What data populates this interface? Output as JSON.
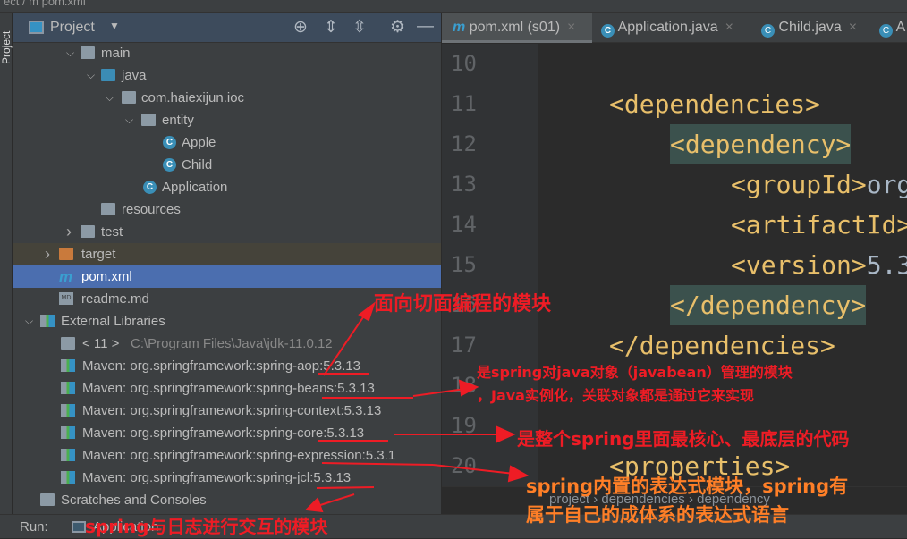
{
  "breadcrumb_top": "ect / m pom.xml",
  "side_stripe": "Project",
  "panel": {
    "title": "Project",
    "icons": [
      "locate-icon",
      "expand-all-icon",
      "collapse-all-icon",
      "gear-icon",
      "minimize-icon"
    ]
  },
  "tree": [
    {
      "label": "main",
      "type": "folder",
      "expanded": true
    },
    {
      "label": "java",
      "type": "source-folder",
      "expanded": true
    },
    {
      "label": "com.haiexijun.ioc",
      "type": "package",
      "expanded": true
    },
    {
      "label": "entity",
      "type": "package",
      "expanded": true
    },
    {
      "label": "Apple",
      "type": "class"
    },
    {
      "label": "Child",
      "type": "class"
    },
    {
      "label": "Application",
      "type": "main-class"
    },
    {
      "label": "resources",
      "type": "resources-folder"
    },
    {
      "label": "test",
      "type": "folder",
      "expanded": false
    },
    {
      "label": "target",
      "type": "excluded-folder",
      "expanded": false
    },
    {
      "label": "pom.xml",
      "type": "maven",
      "selected": true
    },
    {
      "label": "readme.md",
      "type": "markdown"
    },
    {
      "label": "External Libraries",
      "type": "libraries",
      "expanded": true
    },
    {
      "label": "< 11 >",
      "extra": "C:\\Program Files\\Java\\jdk-11.0.12",
      "type": "jdk"
    },
    {
      "label": "Maven: org.springframework:spring-aop:5.3.13",
      "type": "lib"
    },
    {
      "label": "Maven: org.springframework:spring-beans:5.3.13",
      "type": "lib"
    },
    {
      "label": "Maven: org.springframework:spring-context:5.3.13",
      "type": "lib"
    },
    {
      "label": "Maven: org.springframework:spring-core:5.3.13",
      "type": "lib"
    },
    {
      "label": "Maven: org.springframework:spring-expression:5.3.1",
      "type": "lib"
    },
    {
      "label": "Maven: org.springframework:spring-jcl:5.3.13",
      "type": "lib"
    },
    {
      "label": "Scratches and Consoles",
      "type": "scratches"
    }
  ],
  "tabs": [
    {
      "label": "pom.xml (s01)",
      "icon": "maven-icon",
      "active": true
    },
    {
      "label": "Application.java",
      "icon": "main-class-icon"
    },
    {
      "label": "Child.java",
      "icon": "class-icon"
    },
    {
      "label": "A",
      "icon": "class-icon"
    }
  ],
  "code_lines": [
    {
      "num": "10",
      "text": ""
    },
    {
      "num": "11",
      "text": "<dependencies>"
    },
    {
      "num": "12",
      "text": "<dependency>"
    },
    {
      "num": "13",
      "text": "<groupId>",
      "value": "org"
    },
    {
      "num": "14",
      "text": "<artifactId>"
    },
    {
      "num": "15",
      "text": "<version>",
      "value": "5.3"
    },
    {
      "num": "16",
      "text": "</dependency>"
    },
    {
      "num": "17",
      "text": "</dependencies>"
    },
    {
      "num": "18",
      "text": ""
    },
    {
      "num": "19",
      "text": ""
    },
    {
      "num": "20",
      "text": "<properties>"
    }
  ],
  "editor_breadcrumb": [
    "project",
    "dependencies",
    "dependency"
  ],
  "run": {
    "label": "Run:",
    "config": "Application"
  },
  "annotations": {
    "aop": "面向切面编程的模块",
    "beans_1": "是spring对java对象（javabean）管理的模块",
    "beans_2": "，Java实例化，关联对象都是通过它来实现",
    "core": "是整个spring里面最核心、最底层的代码",
    "expression_1": "spring内置的表达式模块，spring有",
    "expression_2": "属于自己的成体系的表达式语言",
    "jcl": "spring与日志进行交互的模块"
  },
  "colors": {
    "selection": "#4b6eaf",
    "annotation_red": "#ee1c25",
    "annotation_orange": "#ff7f27",
    "xml_tag": "#e8bf6a"
  }
}
